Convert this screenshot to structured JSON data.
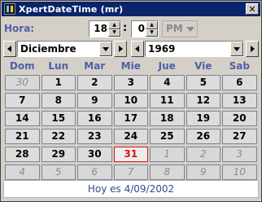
{
  "window": {
    "title": "XpertDateTime (mr)",
    "close_label": "✕"
  },
  "time": {
    "label": "Hora:",
    "hour": "18",
    "minute": "0",
    "ampm": "PM"
  },
  "selectors": {
    "month": "Diciembre",
    "year": "1969"
  },
  "calendar": {
    "weekdays": [
      "Dom",
      "Lun",
      "Mar",
      "Mie",
      "Jue",
      "Vie",
      "Sab"
    ],
    "weeks": [
      [
        {
          "d": "30",
          "other": true
        },
        {
          "d": "1"
        },
        {
          "d": "2"
        },
        {
          "d": "3"
        },
        {
          "d": "4"
        },
        {
          "d": "5"
        },
        {
          "d": "6"
        }
      ],
      [
        {
          "d": "7"
        },
        {
          "d": "8"
        },
        {
          "d": "9"
        },
        {
          "d": "10"
        },
        {
          "d": "11"
        },
        {
          "d": "12"
        },
        {
          "d": "13"
        }
      ],
      [
        {
          "d": "14"
        },
        {
          "d": "15"
        },
        {
          "d": "16"
        },
        {
          "d": "17"
        },
        {
          "d": "18"
        },
        {
          "d": "19"
        },
        {
          "d": "20"
        }
      ],
      [
        {
          "d": "21"
        },
        {
          "d": "22"
        },
        {
          "d": "23"
        },
        {
          "d": "24"
        },
        {
          "d": "25"
        },
        {
          "d": "26"
        },
        {
          "d": "27"
        }
      ],
      [
        {
          "d": "28"
        },
        {
          "d": "29"
        },
        {
          "d": "30"
        },
        {
          "d": "31",
          "today": true
        },
        {
          "d": "1",
          "other": true
        },
        {
          "d": "2",
          "other": true
        },
        {
          "d": "3",
          "other": true
        }
      ],
      [
        {
          "d": "4",
          "other": true
        },
        {
          "d": "5",
          "other": true
        },
        {
          "d": "6",
          "other": true
        },
        {
          "d": "7",
          "other": true
        },
        {
          "d": "8",
          "other": true
        },
        {
          "d": "9",
          "other": true
        },
        {
          "d": "10",
          "other": true
        }
      ]
    ]
  },
  "footer": {
    "today_text": "Hoy es 4/09/2002"
  },
  "colors": {
    "title_bar": "#0a246a",
    "label_blue": "#4f5ea8",
    "today_red": "#e01010"
  }
}
